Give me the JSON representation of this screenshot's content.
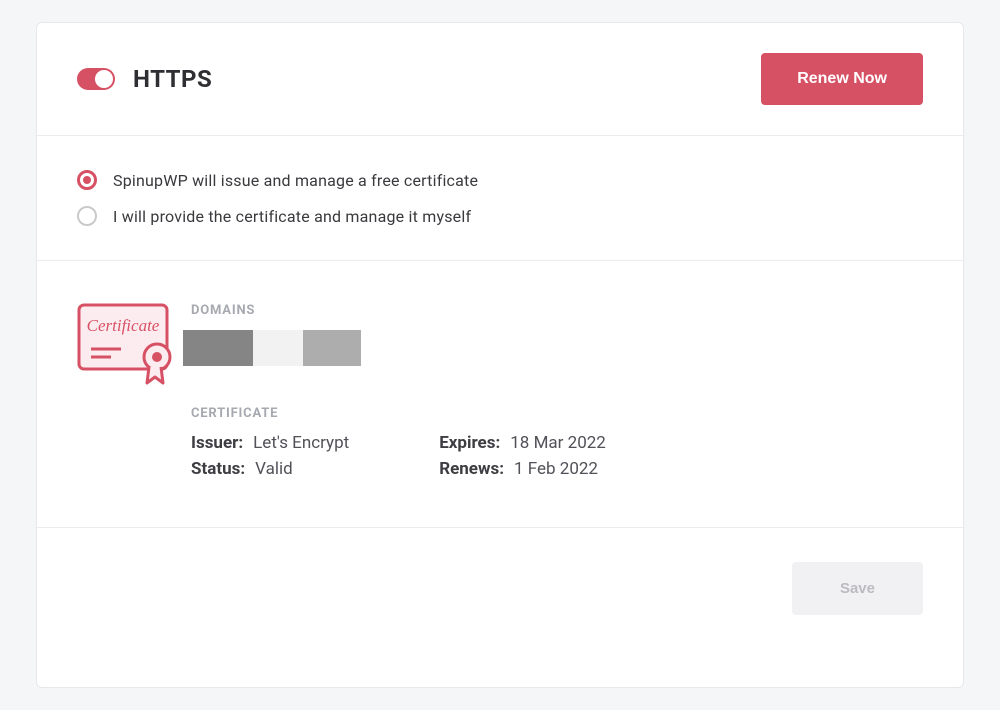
{
  "header": {
    "title": "HTTPS",
    "toggle_on": true,
    "renew_button": "Renew Now"
  },
  "options": {
    "managed": {
      "label": "SpinupWP will issue and manage a free certificate",
      "selected": true
    },
    "self": {
      "label": "I will provide the certificate and manage it myself",
      "selected": false
    }
  },
  "cert_icon": {
    "label": "Certificate"
  },
  "domains": {
    "heading": "DOMAINS"
  },
  "certificate": {
    "heading": "CERTIFICATE",
    "issuer_label": "Issuer:",
    "issuer_value": "Let's Encrypt",
    "status_label": "Status:",
    "status_value": "Valid",
    "expires_label": "Expires:",
    "expires_value": "18 Mar 2022",
    "renews_label": "Renews:",
    "renews_value": "1 Feb 2022"
  },
  "footer": {
    "save_button": "Save"
  }
}
